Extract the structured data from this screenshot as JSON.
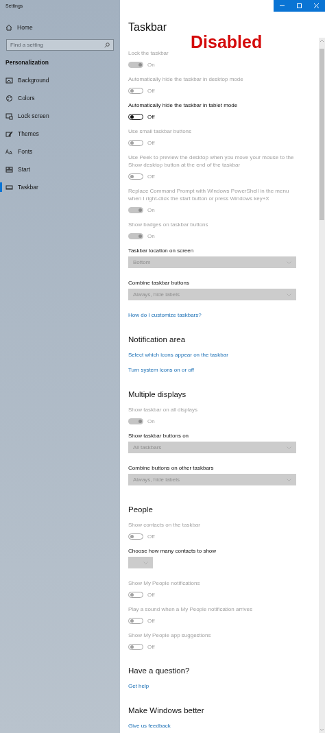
{
  "window": {
    "title": "Settings"
  },
  "sidebar": {
    "home": "Home",
    "search": {
      "placeholder": "Find a setting"
    },
    "group": "Personalization",
    "items": [
      {
        "label": "Background",
        "selected": false
      },
      {
        "label": "Colors",
        "selected": false
      },
      {
        "label": "Lock screen",
        "selected": false
      },
      {
        "label": "Themes",
        "selected": false
      },
      {
        "label": "Fonts",
        "selected": false
      },
      {
        "label": "Start",
        "selected": false
      },
      {
        "label": "Taskbar",
        "selected": true
      }
    ]
  },
  "annotation": "Disabled",
  "page": {
    "title": "Taskbar",
    "sections": [
      {
        "items": [
          {
            "kind": "toggle",
            "label": "Lock the taskbar",
            "on": true,
            "disabled": true,
            "state": "On"
          },
          {
            "kind": "toggle",
            "label": "Automatically hide the taskbar in desktop mode",
            "on": false,
            "disabled": true,
            "state": "Off"
          },
          {
            "kind": "toggle",
            "label": "Automatically hide the taskbar in tablet mode",
            "on": false,
            "disabled": false,
            "state": "Off"
          },
          {
            "kind": "toggle",
            "label": "Use small taskbar buttons",
            "on": false,
            "disabled": true,
            "state": "Off"
          },
          {
            "kind": "toggle",
            "label": "Use Peek to preview the desktop when you move your mouse to the Show desktop button at the end of the taskbar",
            "on": false,
            "disabled": true,
            "state": "Off"
          },
          {
            "kind": "toggle",
            "label": "Replace Command Prompt with Windows PowerShell in the menu when I right-click the start button or press Windows key+X",
            "on": true,
            "disabled": true,
            "state": "On"
          },
          {
            "kind": "toggle",
            "label": "Show badges on taskbar buttons",
            "on": true,
            "disabled": true,
            "state": "On"
          },
          {
            "kind": "dropdown",
            "label": "Taskbar location on screen",
            "value": "Bottom",
            "disabled": true
          },
          {
            "kind": "dropdown",
            "label": "Combine taskbar buttons",
            "value": "Always, hide labels",
            "disabled": true
          },
          {
            "kind": "link",
            "label": "How do I customize taskbars?"
          }
        ]
      },
      {
        "heading": "Notification area",
        "items": [
          {
            "kind": "link",
            "label": "Select which icons appear on the taskbar"
          },
          {
            "kind": "link",
            "label": "Turn system icons on or off"
          }
        ]
      },
      {
        "heading": "Multiple displays",
        "items": [
          {
            "kind": "toggle",
            "label": "Show taskbar on all displays",
            "on": true,
            "disabled": true,
            "state": "On"
          },
          {
            "kind": "dropdown",
            "label": "Show taskbar buttons on",
            "value": "All taskbars",
            "disabled": true
          },
          {
            "kind": "dropdown",
            "label": "Combine buttons on other taskbars",
            "value": "Always, hide labels",
            "disabled": true
          }
        ]
      },
      {
        "heading": "People",
        "items": [
          {
            "kind": "toggle",
            "label": "Show contacts on the taskbar",
            "on": false,
            "disabled": true,
            "state": "Off"
          },
          {
            "kind": "dropdown",
            "label": "Choose how many contacts to show",
            "disabled": true
          },
          {
            "kind": "toggle",
            "label": "Show My People notifications",
            "on": false,
            "disabled": true,
            "state": "Off"
          },
          {
            "kind": "toggle",
            "label": "Play a sound when a My People notification arrives",
            "on": false,
            "disabled": true,
            "state": "Off"
          },
          {
            "kind": "toggle",
            "label": "Show My People app suggestions",
            "on": false,
            "disabled": true,
            "state": "Off"
          }
        ]
      },
      {
        "heading": "Have a question?",
        "items": [
          {
            "kind": "link",
            "label": "Get help"
          }
        ]
      },
      {
        "heading": "Make Windows better",
        "items": [
          {
            "kind": "link",
            "label": "Give us feedback"
          }
        ]
      }
    ]
  }
}
